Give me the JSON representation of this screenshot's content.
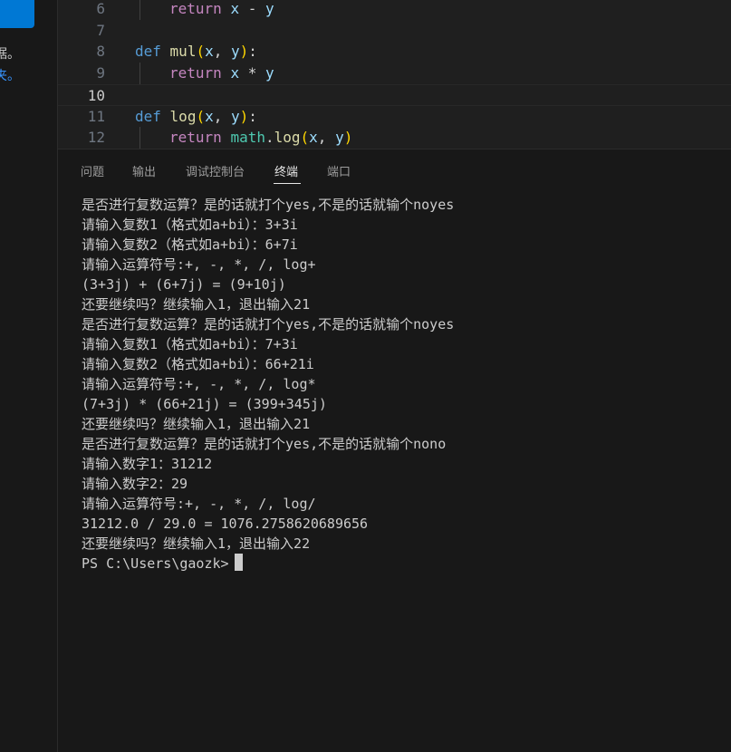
{
  "sidebar": {
    "line1": "据。",
    "line2": "夹。"
  },
  "editor": {
    "lines": [
      {
        "num": "6",
        "tokens": [
          {
            "t": "return",
            "c": "ctl"
          },
          {
            "t": " ",
            "c": "op"
          },
          {
            "t": "x",
            "c": "var"
          },
          {
            "t": " - ",
            "c": "op"
          },
          {
            "t": "y",
            "c": "var"
          }
        ],
        "indent": true
      },
      {
        "num": "7",
        "tokens": []
      },
      {
        "num": "8",
        "tokens": [
          {
            "t": "def",
            "c": "kw"
          },
          {
            "t": " ",
            "c": "op"
          },
          {
            "t": "mul",
            "c": "fn"
          },
          {
            "t": "(",
            "c": "paren"
          },
          {
            "t": "x",
            "c": "var"
          },
          {
            "t": ", ",
            "c": "op"
          },
          {
            "t": "y",
            "c": "var"
          },
          {
            "t": ")",
            "c": "paren"
          },
          {
            "t": ":",
            "c": "op"
          }
        ]
      },
      {
        "num": "9",
        "tokens": [
          {
            "t": "return",
            "c": "ctl"
          },
          {
            "t": " ",
            "c": "op"
          },
          {
            "t": "x",
            "c": "var"
          },
          {
            "t": " * ",
            "c": "op"
          },
          {
            "t": "y",
            "c": "var"
          }
        ],
        "indent": true
      },
      {
        "num": "10",
        "tokens": [],
        "current": true
      },
      {
        "num": "11",
        "tokens": [
          {
            "t": "def",
            "c": "kw"
          },
          {
            "t": " ",
            "c": "op"
          },
          {
            "t": "log",
            "c": "fn"
          },
          {
            "t": "(",
            "c": "paren"
          },
          {
            "t": "x",
            "c": "var"
          },
          {
            "t": ", ",
            "c": "op"
          },
          {
            "t": "y",
            "c": "var"
          },
          {
            "t": ")",
            "c": "paren"
          },
          {
            "t": ":",
            "c": "op"
          }
        ]
      },
      {
        "num": "12",
        "tokens": [
          {
            "t": "return",
            "c": "ctl"
          },
          {
            "t": " ",
            "c": "op"
          },
          {
            "t": "math",
            "c": "cls"
          },
          {
            "t": ".",
            "c": "op"
          },
          {
            "t": "log",
            "c": "fn"
          },
          {
            "t": "(",
            "c": "paren"
          },
          {
            "t": "x",
            "c": "var"
          },
          {
            "t": ", ",
            "c": "op"
          },
          {
            "t": "y",
            "c": "var"
          },
          {
            "t": ")",
            "c": "paren"
          }
        ],
        "indent": true
      }
    ]
  },
  "panel": {
    "tabs": [
      {
        "label": "问题",
        "name": "tab-problems"
      },
      {
        "label": "输出",
        "name": "tab-output"
      },
      {
        "label": "调试控制台",
        "name": "tab-debug-console"
      },
      {
        "label": "终端",
        "name": "tab-terminal",
        "active": true
      },
      {
        "label": "端口",
        "name": "tab-ports"
      }
    ]
  },
  "terminal": {
    "lines": [
      "是否进行复数运算？是的话就打个yes,不是的话就输个noyes",
      "请输入复数1（格式如a+bi）：3+3i",
      "请输入复数2（格式如a+bi）：6+7i",
      "请输入运算符号:+, -, *, /, log+",
      "(3+3j) + (6+7j) = (9+10j)",
      "还要继续吗？继续输入1，退出输入21",
      "是否进行复数运算？是的话就打个yes,不是的话就输个noyes",
      "请输入复数1（格式如a+bi）：7+3i",
      "请输入复数2（格式如a+bi）：66+21i",
      "请输入运算符号:+, -, *, /, log*",
      "(7+3j) * (66+21j) = (399+345j)",
      "还要继续吗？继续输入1，退出输入21",
      "是否进行复数运算？是的话就打个yes,不是的话就输个nono",
      "请输入数字1：31212",
      "请输入数字2：29",
      "请输入运算符号:+, -, *, /, log/",
      "31212.0 / 29.0 = 1076.2758620689656",
      "还要继续吗？继续输入1，退出输入22"
    ],
    "prompt": "PS C:\\Users\\gaozk>"
  }
}
